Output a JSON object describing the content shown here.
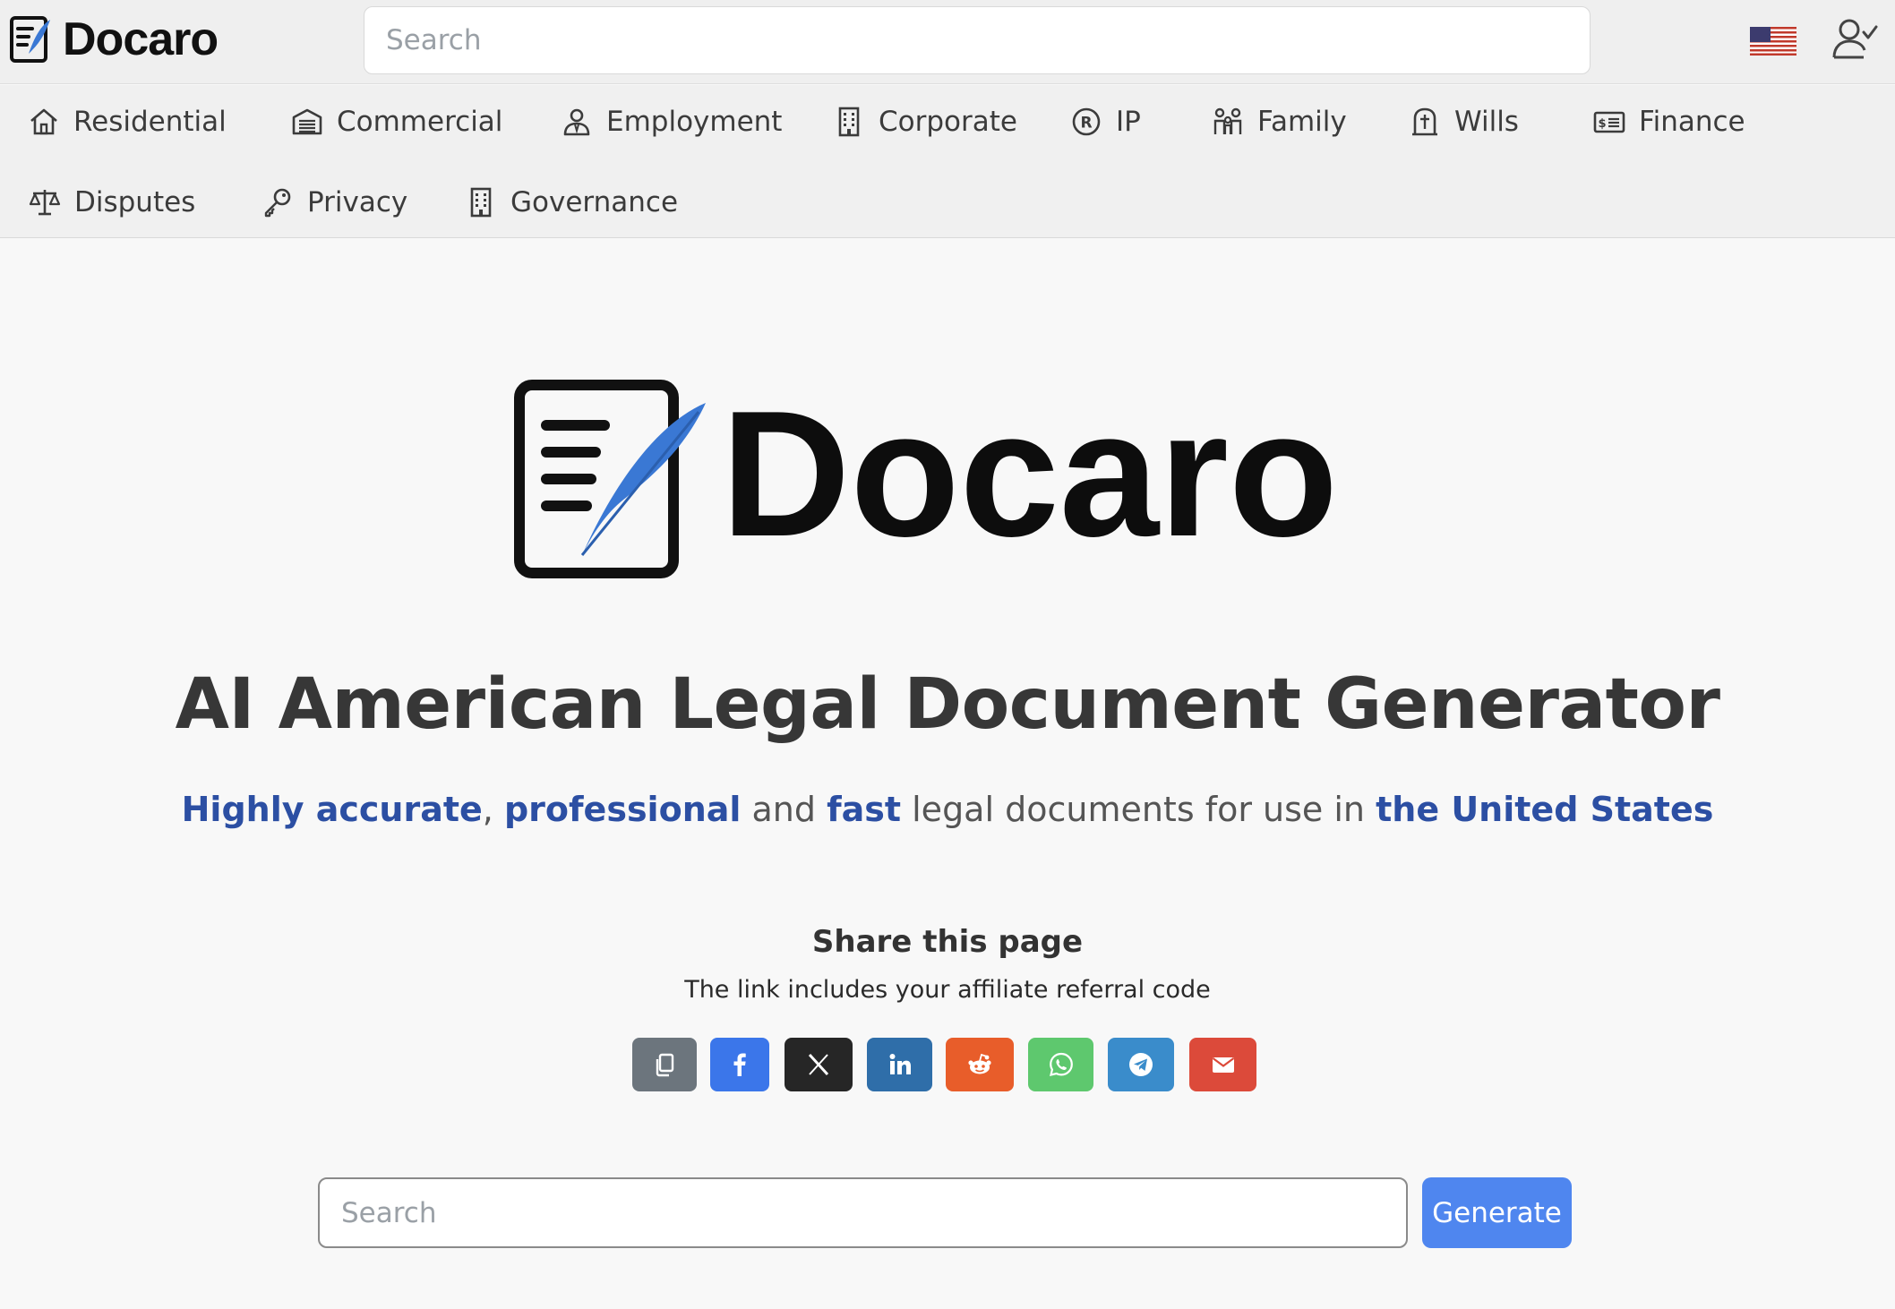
{
  "header": {
    "brand": "Docaro",
    "search": {
      "placeholder": "Search",
      "value": ""
    },
    "flag_icon": "us-flag-icon",
    "account_icon": "user-check-icon"
  },
  "categories": [
    {
      "label": "Residential",
      "icon": "house-icon"
    },
    {
      "label": "Commercial",
      "icon": "warehouse-icon"
    },
    {
      "label": "Employment",
      "icon": "worker-icon"
    },
    {
      "label": "Corporate",
      "icon": "building-icon"
    },
    {
      "label": "IP",
      "icon": "registered-icon"
    },
    {
      "label": "Family",
      "icon": "family-icon"
    },
    {
      "label": "Wills",
      "icon": "grave-icon"
    },
    {
      "label": "Finance",
      "icon": "money-card-icon"
    },
    {
      "label": "Disputes",
      "icon": "scales-icon"
    },
    {
      "label": "Privacy",
      "icon": "key-icon"
    },
    {
      "label": "Governance",
      "icon": "building-icon"
    }
  ],
  "hero": {
    "logo_text": "Docaro",
    "title": "AI American Legal Document Generator",
    "subtitle": {
      "p1": "Highly accurate",
      "s1": ", ",
      "p2": "professional",
      "s2": " and ",
      "p3": "fast",
      "s3": " legal documents for use in ",
      "p4": "the United States"
    }
  },
  "share": {
    "title": "Share this page",
    "note": "The link includes your affiliate referral code",
    "buttons": [
      {
        "name": "copy",
        "icon": "copy-icon",
        "color": "#6c757d"
      },
      {
        "name": "facebook",
        "icon": "facebook-icon",
        "color": "#3b76ea"
      },
      {
        "name": "x",
        "icon": "x-icon",
        "color": "#262626"
      },
      {
        "name": "linkedin",
        "icon": "linkedin-icon",
        "color": "#2f6ea9"
      },
      {
        "name": "reddit",
        "icon": "reddit-icon",
        "color": "#e85d2a"
      },
      {
        "name": "whatsapp",
        "icon": "whatsapp-icon",
        "color": "#5ec86e"
      },
      {
        "name": "telegram",
        "icon": "telegram-icon",
        "color": "#3a8ccb"
      },
      {
        "name": "email",
        "icon": "email-icon",
        "color": "#dc4a3a"
      }
    ]
  },
  "generator": {
    "search": {
      "placeholder": "Search",
      "value": ""
    },
    "button_label": "Generate"
  },
  "colors": {
    "accent": "#4f86ef",
    "highlight_text": "#2c4fa3",
    "feather": "#3a78d4"
  }
}
